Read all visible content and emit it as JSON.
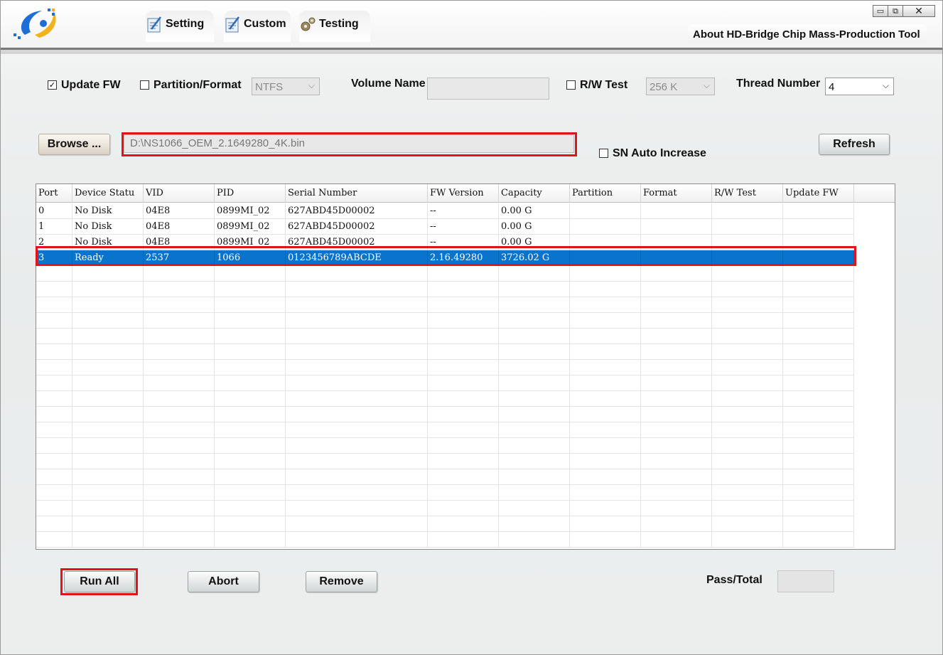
{
  "window": {
    "controls": {
      "minimize": "▭",
      "maximize": "⧉",
      "close": "✕"
    }
  },
  "nav": {
    "tabs": [
      {
        "label": "Setting",
        "icon": "setting-notepad-icon"
      },
      {
        "label": "Custom",
        "icon": "custom-notepad-icon"
      },
      {
        "label": "Testing",
        "icon": "testing-gears-icon"
      }
    ],
    "about": "About HD-Bridge Chip Mass-Production Tool"
  },
  "options": {
    "update_fw": {
      "label": "Update FW",
      "checked": true
    },
    "partition_format": {
      "label": "Partition/Format",
      "checked": false,
      "value": "NTFS"
    },
    "volume_name": {
      "label": "Volume Name",
      "value": ""
    },
    "rw_test": {
      "label": "R/W Test",
      "checked": false,
      "value": "256 K"
    },
    "thread_number": {
      "label": "Thread Number",
      "value": "4"
    },
    "sn_auto_increase": {
      "label": "SN Auto Increase",
      "checked": false
    }
  },
  "file": {
    "browse_label": "Browse ...",
    "path": "D:\\NS1066_OEM_2.1649280_4K.bin",
    "refresh_label": "Refresh"
  },
  "table": {
    "columns": [
      "Port",
      "Device Statu",
      "VID",
      "PID",
      "Serial Number",
      "FW Version",
      "Capacity",
      "Partition",
      "Format",
      "R/W Test",
      "Update FW"
    ],
    "rows": [
      [
        "0",
        "No Disk",
        "04E8",
        "0899MI_02",
        "627ABD45D00002",
        "--",
        "0.00 G",
        "",
        "",
        "",
        ""
      ],
      [
        "1",
        "No Disk",
        "04E8",
        "0899MI_02",
        "627ABD45D00002",
        "--",
        "0.00 G",
        "",
        "",
        "",
        ""
      ],
      [
        "2",
        "No Disk",
        "04E8",
        "0899MI_02",
        "627ABD45D00002",
        "--",
        "0.00 G",
        "",
        "",
        "",
        ""
      ],
      [
        "3",
        "Ready",
        "2537",
        "1066",
        "0123456789ABCDE",
        "2.16.49280",
        "3726.02 G",
        "",
        "",
        "",
        ""
      ]
    ],
    "selected_row": 3
  },
  "actions": {
    "run_all": "Run All",
    "abort": "Abort",
    "remove": "Remove",
    "pass_total_label": "Pass/Total",
    "pass_total_value": ""
  },
  "colors": {
    "highlight": "#e3131c",
    "selection": "#0a74cc"
  }
}
